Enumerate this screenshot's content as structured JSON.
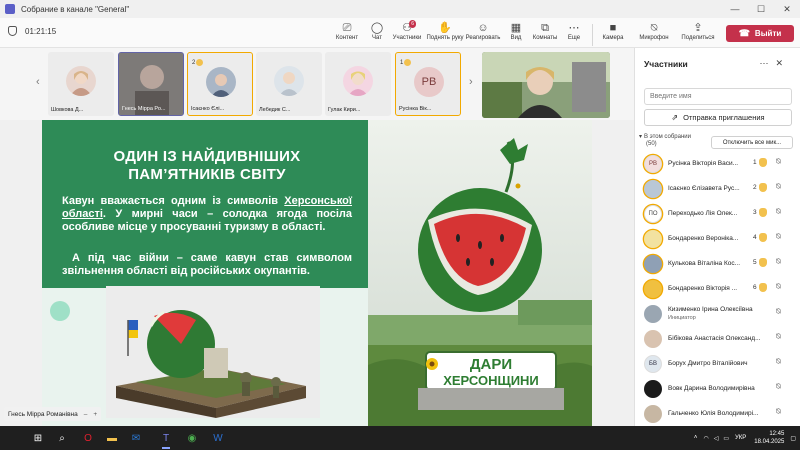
{
  "window": {
    "title": "Собрание в канале \"General\"",
    "controls": [
      "—",
      "☐",
      "✕"
    ]
  },
  "toolbar": {
    "timer": "01:21:15",
    "buttons": [
      {
        "label": "Контент",
        "icon": "share-content-icon",
        "glyph": "⎚"
      },
      {
        "label": "Чат",
        "icon": "chat-icon",
        "glyph": "💬"
      },
      {
        "label": "Участники",
        "icon": "people-icon",
        "glyph": "👥",
        "badge": "6"
      },
      {
        "label": "Поднять руку",
        "icon": "raise-hand-icon",
        "glyph": "✋"
      },
      {
        "label": "Реагировать",
        "icon": "react-icon",
        "glyph": "☺"
      },
      {
        "label": "Вид",
        "icon": "view-icon",
        "glyph": "▦"
      },
      {
        "label": "Комнаты",
        "icon": "rooms-icon",
        "glyph": "⧉"
      },
      {
        "label": "Еще",
        "icon": "more-icon",
        "glyph": "⋯"
      },
      {
        "label": "Камера",
        "icon": "camera-icon",
        "glyph": "■"
      },
      {
        "label": "Микрофон",
        "icon": "microphone-off-icon",
        "glyph": "🎙"
      },
      {
        "label": "Поделиться",
        "icon": "share-icon",
        "glyph": "⬆"
      }
    ],
    "leave_label": "Выйти",
    "leave_color": "#c4314b"
  },
  "strip": {
    "tiles": [
      {
        "name": "Шовкова Д...",
        "type": "photo"
      },
      {
        "name": "Гнесь Мірра Ро...",
        "type": "blur",
        "active": true
      },
      {
        "name": "Ісаєнко Єлі...",
        "type": "photo",
        "hand": "2",
        "selected": true
      },
      {
        "name": "Лебедик С...",
        "type": "photo"
      },
      {
        "name": "Гулак Кири...",
        "type": "photo"
      },
      {
        "name": "Русінка Вік...",
        "type": "initials",
        "initials": "РВ",
        "hand": "1",
        "selected": true
      }
    ]
  },
  "slide": {
    "title_line1": "ОДИН ІЗ НАЙДИВНІШИХ",
    "title_line2": "ПАМ’ЯТНИКІВ СВІТУ",
    "p1_a": "Кавун вважається одним із символів ",
    "p1_link": "Херсонської області",
    "p1_b": ". У мирні часи – солодка ягода посіла особливе місце у просуванні туризму в області.",
    "p2": "А під час війни – саме кавун став символом звільнення області від російських окупантів.",
    "sign_line1": "ДАРИ",
    "sign_line2": "ХЕРСОНЩИНИ",
    "presenter_name": "Гнесь Мірра Романівна",
    "colors": {
      "green": "#2e8b57",
      "light": "#e9f3ee"
    }
  },
  "panel": {
    "title": "Участники",
    "search_placeholder": "Введите имя",
    "invite_label": "Отправка приглашения",
    "section_line1": "В этом собрании",
    "section_line2": "(50)",
    "mute_all_label": "Отключить все мик...",
    "participants": [
      {
        "name": "Русінка Вікторія Васи...",
        "initials": "РВ",
        "hand": "1",
        "av": "initials",
        "bg": "#f3dede",
        "fg": "#7a3b3b"
      },
      {
        "name": "Ісаєнко Єлізавета Рус...",
        "initials": "",
        "hand": "2",
        "av": "photo",
        "bg": "#b9c7d6"
      },
      {
        "name": "Переходько Лія Олек...",
        "initials": "ПО",
        "hand": "3",
        "av": "initials",
        "bg": "#fff",
        "fg": "#444"
      },
      {
        "name": "Бондаренко Вероніка...",
        "initials": "",
        "hand": "4",
        "av": "photo",
        "bg": "#f2e2a0"
      },
      {
        "name": "Кулькова Віталіна Кос...",
        "initials": "",
        "hand": "5",
        "av": "photo",
        "bg": "#8fa0b5"
      },
      {
        "name": "Бондаренко Вікторія ...",
        "initials": "",
        "hand": "6",
        "av": "photo",
        "bg": "#f0c040"
      },
      {
        "name": "Кизименко Ірина Олексіївна",
        "role": "Инициатор",
        "initials": "",
        "av": "photo",
        "bg": "#9aa6b2"
      },
      {
        "name": "Бібікова Анастасія Олександ...",
        "initials": "",
        "av": "photo",
        "bg": "#d9c3b0"
      },
      {
        "name": "Боруx Дмитро Віталійович",
        "initials": "БВ",
        "av": "initials",
        "bg": "#dfe7ee",
        "fg": "#334"
      },
      {
        "name": "Вовк Дарина Володимирівна",
        "initials": "",
        "av": "photo",
        "bg": "#1b1b1b"
      },
      {
        "name": "Гальченко Юлія Володимирі...",
        "initials": "",
        "av": "photo",
        "bg": "#c7b7a3"
      }
    ]
  },
  "taskbar": {
    "apps": [
      "windows-start-icon",
      "search-icon",
      "opera-icon",
      "file-explorer-icon",
      "outlook-icon",
      "teams-icon",
      "chrome-icon",
      "word-icon"
    ],
    "lang": "УКР",
    "time": "12:45",
    "date": "18.04.2025"
  }
}
